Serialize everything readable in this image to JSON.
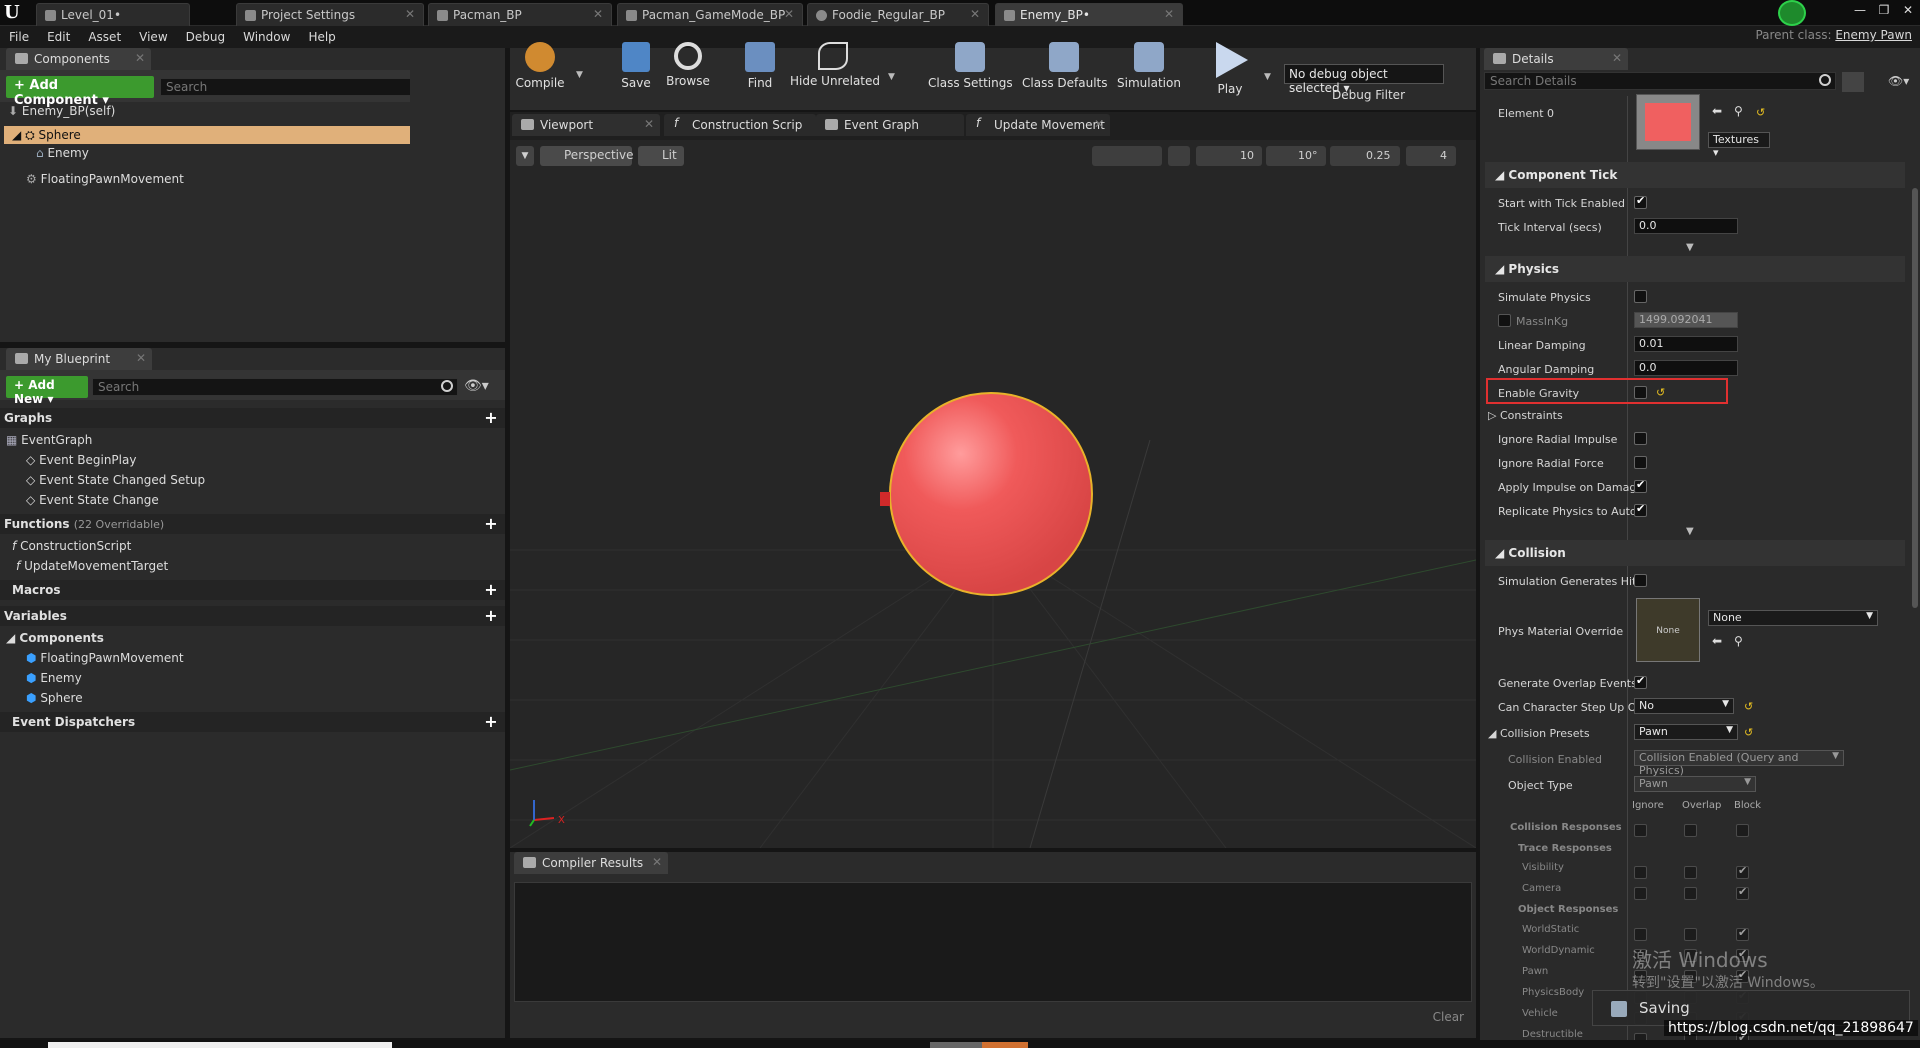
{
  "tabs": [
    "Level_01•",
    "Project Settings",
    "Pacman_BP",
    "Pacman_GameMode_BP",
    "Foodie_Regular_BP",
    "Enemy_BP•"
  ],
  "menu": [
    "File",
    "Edit",
    "Asset",
    "View",
    "Debug",
    "Window",
    "Help"
  ],
  "parent_class": {
    "label": "Parent class:",
    "value": "Enemy Pawn"
  },
  "components": {
    "tab": "Components",
    "add_button": "+ Add Component ▾",
    "search_placeholder": "Search",
    "self": "Enemy_BP(self)",
    "items": [
      "Sphere",
      "Enemy",
      "FloatingPawnMovement"
    ]
  },
  "my_blueprint": {
    "tab": "My Blueprint",
    "add_button": "+ Add New ▾",
    "search_placeholder": "Search",
    "graphs_label": "Graphs",
    "graph": "EventGraph",
    "events": [
      "Event BeginPlay",
      "Event State Changed Setup",
      "Event State Change"
    ],
    "functions_label": "Functions",
    "functions_overridable": "(22 Overridable)",
    "functions": [
      "ConstructionScript",
      "UpdateMovementTarget"
    ],
    "macros_label": "Macros",
    "variables_label": "Variables",
    "components_label": "Components",
    "components": [
      "FloatingPawnMovement",
      "Enemy",
      "Sphere"
    ],
    "dispatchers_label": "Event Dispatchers"
  },
  "toolbar": {
    "compile": "Compile",
    "save": "Save",
    "browse": "Browse",
    "find": "Find",
    "hide_unrelated": "Hide Unrelated",
    "class_settings": "Class Settings",
    "class_defaults": "Class Defaults",
    "simulation": "Simulation",
    "play": "Play",
    "debug_object": "No debug object selected ▾",
    "debug_filter": "Debug Filter"
  },
  "editor_tabs": [
    "Viewport",
    "Construction Scrip",
    "Event Graph",
    "Update Movement"
  ],
  "viewport": {
    "perspective": "Perspective",
    "lit": "Lit",
    "grid": "10",
    "angle": "10°",
    "scale": "0.25",
    "camera_speed": "4",
    "sphere_color": "#f05a5a"
  },
  "compiler": {
    "tab": "Compiler Results",
    "clear": "Clear"
  },
  "details": {
    "tab": "Details",
    "search_placeholder": "Search Details",
    "element0": "Element 0",
    "textures": "Textures ▾",
    "component_tick": "Component Tick",
    "start_tick": "Start with Tick Enabled",
    "tick_interval": "Tick Interval (secs)",
    "tick_interval_val": "0.0",
    "physics": "Physics",
    "simulate_physics": "Simulate Physics",
    "mass": "MassInKg",
    "mass_val": "1499.092041",
    "linear_damping": "Linear Damping",
    "linear_damping_val": "0.01",
    "angular_damping": "Angular Damping",
    "angular_damping_val": "0.0",
    "enable_gravity": "Enable Gravity",
    "constraints": "Constraints",
    "ignore_radial_impulse": "Ignore Radial Impulse",
    "ignore_radial_force": "Ignore Radial Force",
    "apply_impulse": "Apply Impulse on Damage",
    "replicate_physics": "Replicate Physics to Auto",
    "collision": "Collision",
    "sim_gen_hit": "Simulation Generates Hit",
    "phys_material": "Phys Material Override",
    "none": "None",
    "gen_overlap": "Generate Overlap Events",
    "can_step": "Can Character Step Up On",
    "can_step_val": "No",
    "collision_presets": "Collision Presets",
    "presets_val": "Pawn",
    "collision_enabled": "Collision Enabled",
    "collision_enabled_val": "Collision Enabled (Query and Physics)",
    "object_type": "Object Type",
    "object_type_val": "Pawn",
    "col_ignore": "Ignore",
    "col_overlap": "Overlap",
    "col_block": "Block",
    "collision_responses": "Collision Responses",
    "trace_responses": "Trace Responses",
    "visibility": "Visibility",
    "camera": "Camera",
    "object_responses": "Object Responses",
    "object_rows": [
      "WorldStatic",
      "WorldDynamic",
      "Pawn",
      "PhysicsBody",
      "Vehicle",
      "Destructible"
    ]
  },
  "overlay": {
    "watermark1": "激活 Windows",
    "watermark2": "转到\"设置\"以激活 Windows。",
    "saving": "Saving",
    "url": "https://blog.csdn.net/qq_21898647"
  }
}
